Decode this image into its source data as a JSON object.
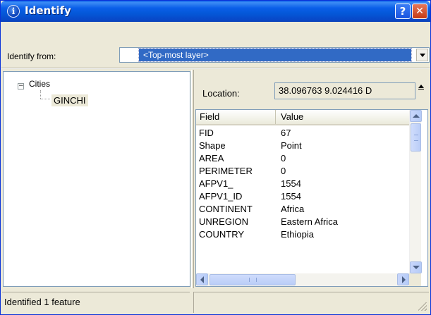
{
  "window": {
    "title": "Identify",
    "title_icon": "info-icon",
    "title_icon_glyph": "i",
    "help_glyph": "?",
    "close_glyph": "✕"
  },
  "identify_from": {
    "label": "Identify from:",
    "selected": "<Top-most layer>"
  },
  "tree": {
    "expander_glyph": "−",
    "root_label": "Cities",
    "children": [
      "GINCHI"
    ]
  },
  "location": {
    "label": "Location:",
    "value": "38.096763  9.024416 D"
  },
  "grid": {
    "columns": [
      "Field",
      "Value"
    ],
    "rows": [
      {
        "field": "FID",
        "value": "67"
      },
      {
        "field": "Shape",
        "value": "Point"
      },
      {
        "field": "AREA",
        "value": "0"
      },
      {
        "field": "PERIMETER",
        "value": "0"
      },
      {
        "field": "AFPV1_",
        "value": "1554"
      },
      {
        "field": "AFPV1_ID",
        "value": "1554"
      },
      {
        "field": "CONTINENT",
        "value": "Africa"
      },
      {
        "field": "UNREGION",
        "value": "Eastern Africa"
      },
      {
        "field": "COUNTRY",
        "value": "Ethiopia"
      }
    ]
  },
  "status": {
    "text": "Identified 1 feature"
  },
  "colors": {
    "titlebar": "#0a5ee8",
    "selection": "#316ac5",
    "window_bg": "#ece9d8"
  }
}
